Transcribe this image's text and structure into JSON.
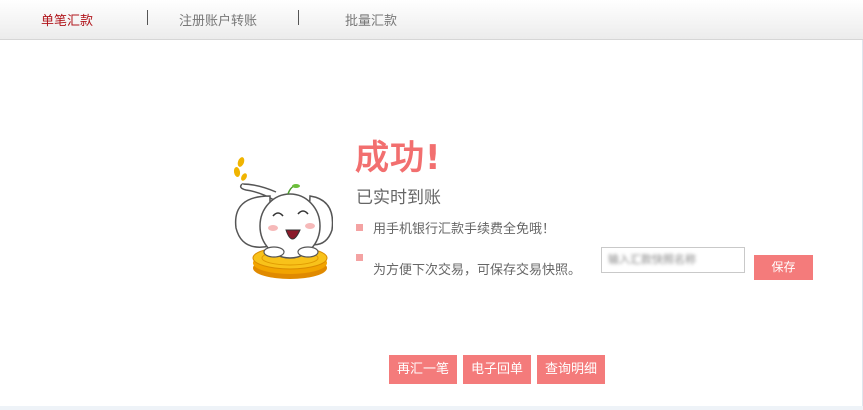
{
  "tabs": [
    {
      "label": "单笔汇款",
      "active": true
    },
    {
      "label": "注册账户转账",
      "active": false
    },
    {
      "label": "批量汇款",
      "active": false
    }
  ],
  "result": {
    "title": "成功!",
    "subtitle": "已实时到账"
  },
  "tips": {
    "fee": "用手机银行汇款手续费全免哦！",
    "snapshot": "为方便下次交易，可保存交易快照。"
  },
  "snapshot": {
    "value": "输入汇款快照名称",
    "save_label": "保存"
  },
  "actions": {
    "again_label": "再汇一笔",
    "receipt_label": "电子回单",
    "details_label": "查询明细"
  },
  "colors": {
    "accent": "#f47b7b",
    "title": "#f26f6f",
    "active_tab": "#b0151b"
  },
  "icons": {
    "mascot": "elephant-on-coin-icon"
  }
}
